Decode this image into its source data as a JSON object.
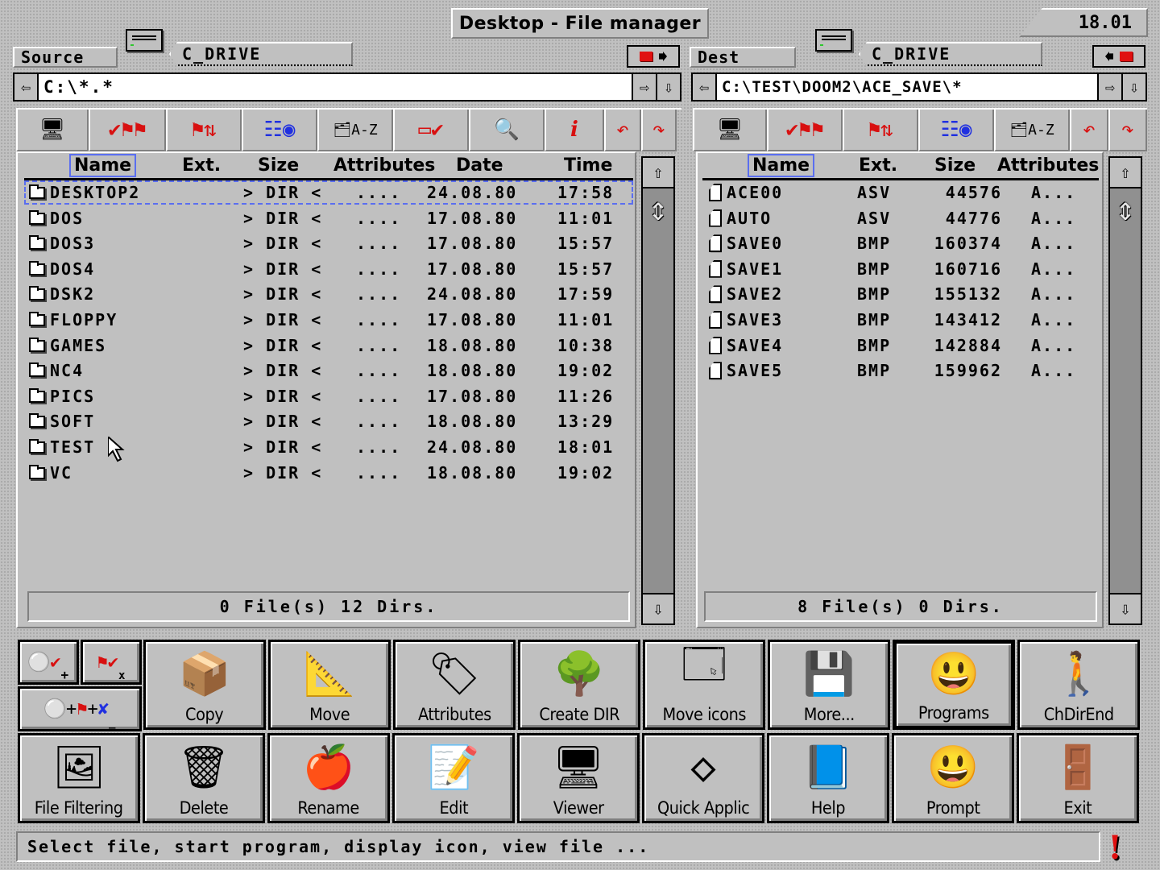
{
  "window": {
    "title": "Desktop - File manager",
    "clock": "18.01"
  },
  "source": {
    "label": "Source",
    "drive": "C_DRIVE",
    "path": "C:\\*.*",
    "columns": [
      "Name",
      "Ext.",
      "Size",
      "Attributes",
      "Date",
      "Time"
    ],
    "rows": [
      {
        "name": "DESKTOP2",
        "size": "> DIR <",
        "attr": "....",
        "date": "24.08.80",
        "time": "17:58"
      },
      {
        "name": "DOS",
        "size": "> DIR <",
        "attr": "....",
        "date": "17.08.80",
        "time": "11:01"
      },
      {
        "name": "DOS3",
        "size": "> DIR <",
        "attr": "....",
        "date": "17.08.80",
        "time": "15:57"
      },
      {
        "name": "DOS4",
        "size": "> DIR <",
        "attr": "....",
        "date": "17.08.80",
        "time": "15:57"
      },
      {
        "name": "DSK2",
        "size": "> DIR <",
        "attr": "....",
        "date": "24.08.80",
        "time": "17:59"
      },
      {
        "name": "FLOPPY",
        "size": "> DIR <",
        "attr": "....",
        "date": "17.08.80",
        "time": "11:01"
      },
      {
        "name": "GAMES",
        "size": "> DIR <",
        "attr": "....",
        "date": "18.08.80",
        "time": "10:38"
      },
      {
        "name": "NC4",
        "size": "> DIR <",
        "attr": "....",
        "date": "18.08.80",
        "time": "19:02"
      },
      {
        "name": "PICS",
        "size": "> DIR <",
        "attr": "....",
        "date": "17.08.80",
        "time": "11:26"
      },
      {
        "name": "SOFT",
        "size": "> DIR <",
        "attr": "....",
        "date": "18.08.80",
        "time": "13:29"
      },
      {
        "name": "TEST",
        "size": "> DIR <",
        "attr": "....",
        "date": "24.08.80",
        "time": "18:01"
      },
      {
        "name": "VC",
        "size": "> DIR <",
        "attr": "....",
        "date": "18.08.80",
        "time": "19:02"
      }
    ],
    "status": "0 File(s) 12 Dirs."
  },
  "dest": {
    "label": "Dest",
    "drive": "C_DRIVE",
    "path": "C:\\TEST\\DOOM2\\ACE_SAVE\\*",
    "columns": [
      "Name",
      "Ext.",
      "Size",
      "Attributes"
    ],
    "rows": [
      {
        "name": "ACE00",
        "ext": "ASV",
        "size": "44576",
        "attr": "A..."
      },
      {
        "name": "AUTO",
        "ext": "ASV",
        "size": "44776",
        "attr": "A..."
      },
      {
        "name": "SAVE0",
        "ext": "BMP",
        "size": "160374",
        "attr": "A..."
      },
      {
        "name": "SAVE1",
        "ext": "BMP",
        "size": "160716",
        "attr": "A..."
      },
      {
        "name": "SAVE2",
        "ext": "BMP",
        "size": "155132",
        "attr": "A..."
      },
      {
        "name": "SAVE3",
        "ext": "BMP",
        "size": "143412",
        "attr": "A..."
      },
      {
        "name": "SAVE4",
        "ext": "BMP",
        "size": "142884",
        "attr": "A..."
      },
      {
        "name": "SAVE5",
        "ext": "BMP",
        "size": "159962",
        "attr": "A..."
      }
    ],
    "status": "8 File(s) 0 Dirs."
  },
  "toolbar_icons": [
    "drive-select-icon",
    "select-all-icon",
    "compare-dirs-icon",
    "tree-icon",
    "sort-az-icon",
    "select-check-icon",
    "find-icon",
    "info-icon",
    "undo-icon",
    "redo-icon"
  ],
  "actions": {
    "small": [
      "+",
      "x",
      "_"
    ],
    "row1": [
      "Copy",
      "Move",
      "Attributes",
      "Create DIR",
      "Move icons",
      "More...",
      "Programs",
      "ChDirEnd"
    ],
    "row2": [
      "File Filtering",
      "Delete",
      "Rename",
      "Edit",
      "Viewer",
      "Quick Applic",
      "Help",
      "Prompt",
      "Exit"
    ]
  },
  "statusline": "Select file, start program, display icon, view file ...",
  "colors": {
    "background": "#c0c0c0",
    "focus": "#5a6ef0",
    "accent_red": "#e01010",
    "accent_blue": "#2030e0"
  }
}
